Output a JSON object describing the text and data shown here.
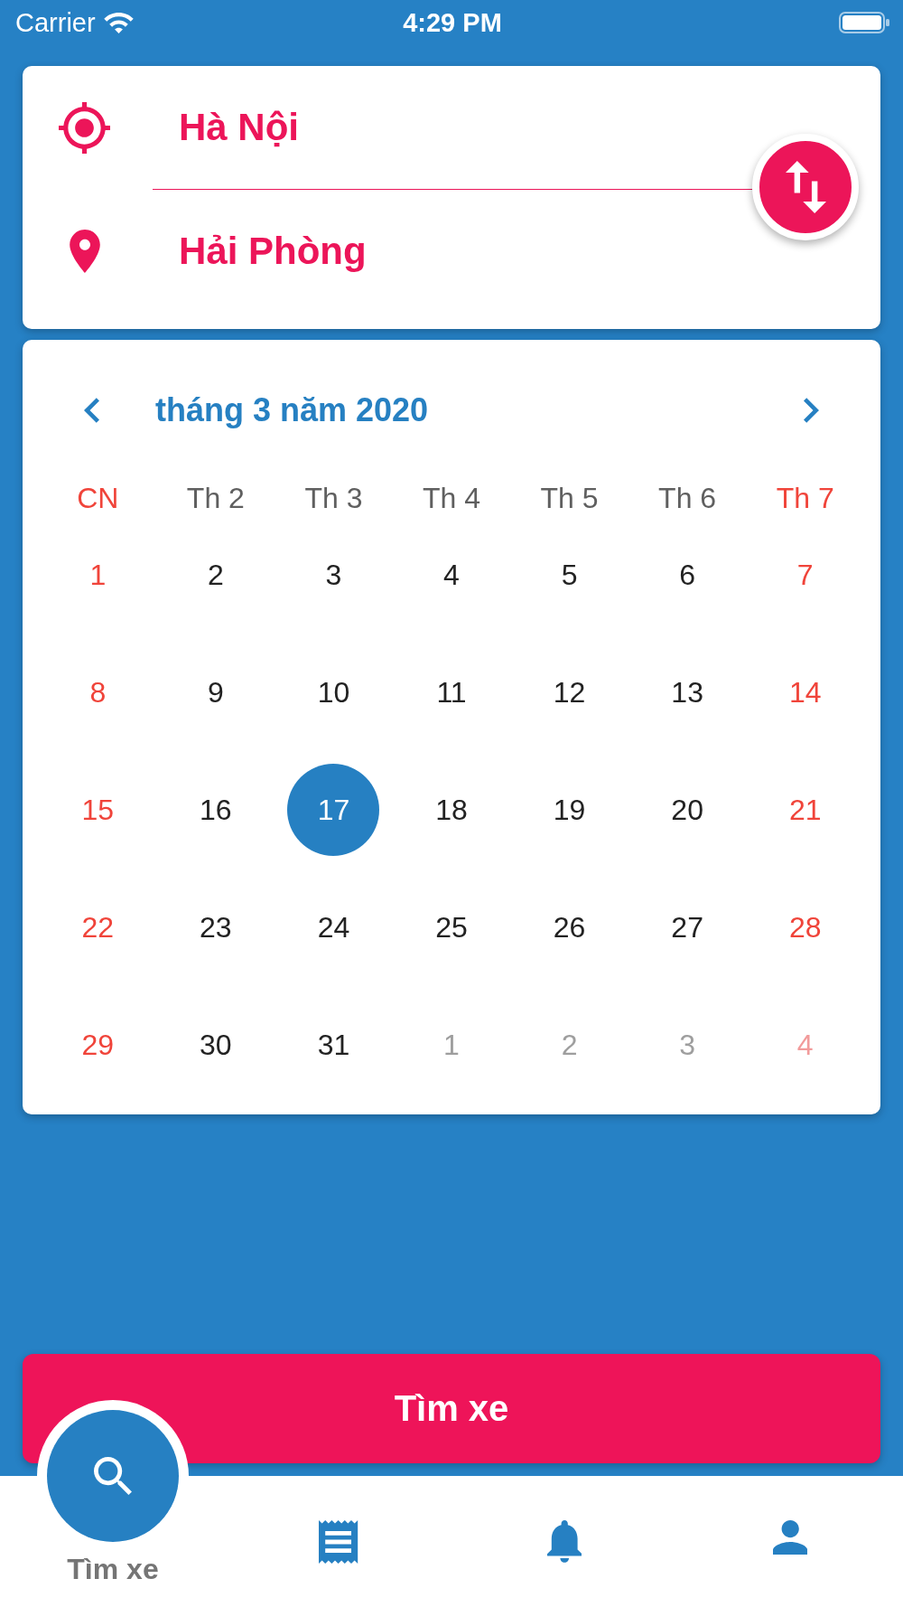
{
  "status_bar": {
    "carrier": "Carrier",
    "time": "4:29 PM"
  },
  "route": {
    "origin": "Hà Nội",
    "destination": "Hải Phòng"
  },
  "calendar": {
    "month_title": "tháng 3 năm 2020",
    "weekdays": [
      {
        "label": "CN",
        "weekend": true
      },
      {
        "label": "Th 2",
        "weekend": false
      },
      {
        "label": "Th 3",
        "weekend": false
      },
      {
        "label": "Th 4",
        "weekend": false
      },
      {
        "label": "Th 5",
        "weekend": false
      },
      {
        "label": "Th 6",
        "weekend": false
      },
      {
        "label": "Th 7",
        "weekend": true
      }
    ],
    "days": [
      {
        "day": "1",
        "weekend": true,
        "outside_month": false,
        "selected": false
      },
      {
        "day": "2",
        "weekend": false,
        "outside_month": false,
        "selected": false
      },
      {
        "day": "3",
        "weekend": false,
        "outside_month": false,
        "selected": false
      },
      {
        "day": "4",
        "weekend": false,
        "outside_month": false,
        "selected": false
      },
      {
        "day": "5",
        "weekend": false,
        "outside_month": false,
        "selected": false
      },
      {
        "day": "6",
        "weekend": false,
        "outside_month": false,
        "selected": false
      },
      {
        "day": "7",
        "weekend": true,
        "outside_month": false,
        "selected": false
      },
      {
        "day": "8",
        "weekend": true,
        "outside_month": false,
        "selected": false
      },
      {
        "day": "9",
        "weekend": false,
        "outside_month": false,
        "selected": false
      },
      {
        "day": "10",
        "weekend": false,
        "outside_month": false,
        "selected": false
      },
      {
        "day": "11",
        "weekend": false,
        "outside_month": false,
        "selected": false
      },
      {
        "day": "12",
        "weekend": false,
        "outside_month": false,
        "selected": false
      },
      {
        "day": "13",
        "weekend": false,
        "outside_month": false,
        "selected": false
      },
      {
        "day": "14",
        "weekend": true,
        "outside_month": false,
        "selected": false
      },
      {
        "day": "15",
        "weekend": true,
        "outside_month": false,
        "selected": false
      },
      {
        "day": "16",
        "weekend": false,
        "outside_month": false,
        "selected": false
      },
      {
        "day": "17",
        "weekend": false,
        "outside_month": false,
        "selected": true
      },
      {
        "day": "18",
        "weekend": false,
        "outside_month": false,
        "selected": false
      },
      {
        "day": "19",
        "weekend": false,
        "outside_month": false,
        "selected": false
      },
      {
        "day": "20",
        "weekend": false,
        "outside_month": false,
        "selected": false
      },
      {
        "day": "21",
        "weekend": true,
        "outside_month": false,
        "selected": false
      },
      {
        "day": "22",
        "weekend": true,
        "outside_month": false,
        "selected": false
      },
      {
        "day": "23",
        "weekend": false,
        "outside_month": false,
        "selected": false
      },
      {
        "day": "24",
        "weekend": false,
        "outside_month": false,
        "selected": false
      },
      {
        "day": "25",
        "weekend": false,
        "outside_month": false,
        "selected": false
      },
      {
        "day": "26",
        "weekend": false,
        "outside_month": false,
        "selected": false
      },
      {
        "day": "27",
        "weekend": false,
        "outside_month": false,
        "selected": false
      },
      {
        "day": "28",
        "weekend": true,
        "outside_month": false,
        "selected": false
      },
      {
        "day": "29",
        "weekend": true,
        "outside_month": false,
        "selected": false
      },
      {
        "day": "30",
        "weekend": false,
        "outside_month": false,
        "selected": false
      },
      {
        "day": "31",
        "weekend": false,
        "outside_month": false,
        "selected": false
      },
      {
        "day": "1",
        "weekend": false,
        "outside_month": true,
        "selected": false
      },
      {
        "day": "2",
        "weekend": false,
        "outside_month": true,
        "selected": false
      },
      {
        "day": "3",
        "weekend": false,
        "outside_month": true,
        "selected": false
      },
      {
        "day": "4",
        "weekend": true,
        "outside_month": true,
        "selected": false
      }
    ]
  },
  "search_button": {
    "label": "Tìm xe"
  },
  "bottom_nav": [
    {
      "kind": "search",
      "label": "Tìm xe",
      "selected": true
    },
    {
      "kind": "tickets",
      "selected": false
    },
    {
      "kind": "notifications",
      "selected": false
    },
    {
      "kind": "account",
      "selected": false
    }
  ]
}
